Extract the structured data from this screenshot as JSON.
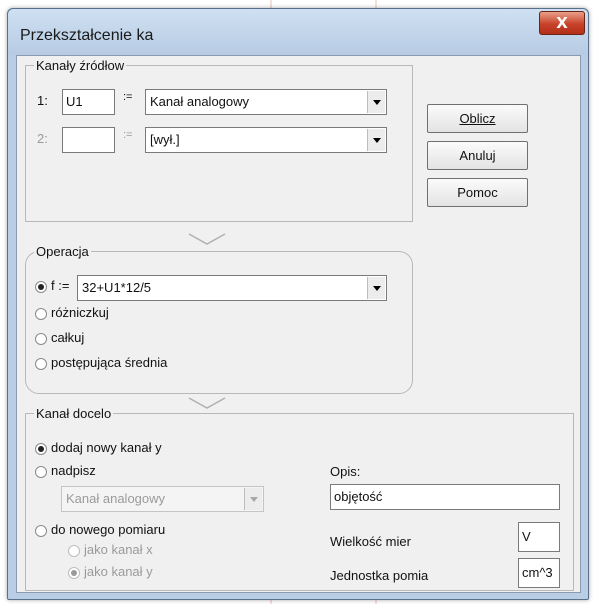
{
  "window": {
    "title": "Przekształcenie ka",
    "close_glyph": "X"
  },
  "sources": {
    "legend": "Kanały źródłow",
    "row1": {
      "num": "1:",
      "value": "U1",
      "assign": ":=",
      "channel": "Kanał analogowy"
    },
    "row2": {
      "num": "2:",
      "value": "",
      "assign": ":=",
      "channel": "[wył.]"
    }
  },
  "buttons": {
    "compute": "Oblicz",
    "cancel": "Anuluj",
    "help": "Pomoc"
  },
  "operation": {
    "legend": "Operacja",
    "formula_prefix": "f :=",
    "formula": "32+U1*12/5",
    "options": [
      "różniczkuj",
      "całkuj",
      "postępująca średnia"
    ]
  },
  "target": {
    "legend": "Kanał docelo",
    "opt_new_channel": "dodaj nowy kanał y",
    "opt_overwrite": "nadpisz",
    "overwrite_select": "Kanał analogowy",
    "opt_new_measurement": "do nowego pomiaru",
    "sub_as_x": "jako kanał x",
    "sub_as_y": "jako kanał y",
    "desc_label": "Opis:",
    "desc_value": "objętość",
    "quantity_label": "Wielkość mier",
    "quantity_value": "V",
    "unit_label": "Jednostka pomia",
    "unit_value": "cm^3"
  }
}
